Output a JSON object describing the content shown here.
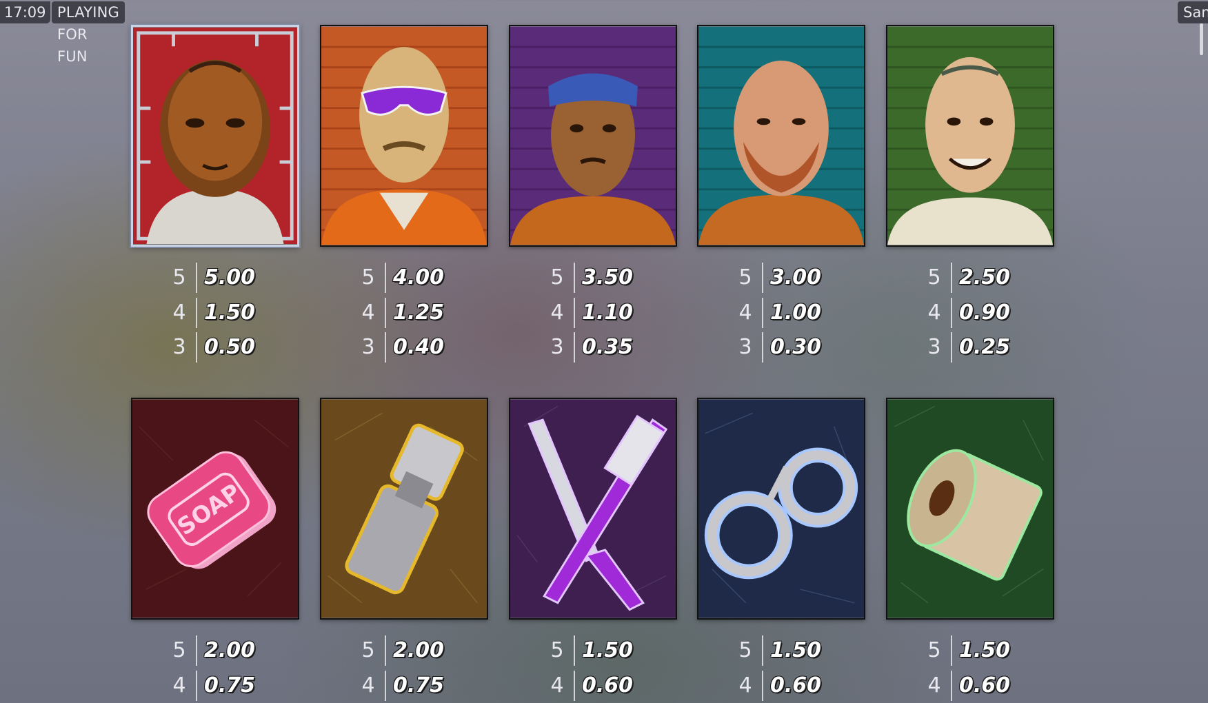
{
  "status_bar": {
    "clock": "17:09",
    "mode": "PLAYING FOR FUN",
    "right_label": "San"
  },
  "paytable": {
    "row1": [
      {
        "name": "red-inmate",
        "icon": "bald-inmate-red-frame-icon",
        "bg": "#b8262a",
        "pays": [
          {
            "count": "5",
            "value": "5.00"
          },
          {
            "count": "4",
            "value": "1.50"
          },
          {
            "count": "3",
            "value": "0.50"
          }
        ]
      },
      {
        "name": "orange-inmate",
        "icon": "inmate-sunglasses-icon",
        "bg": "#c85a26",
        "pays": [
          {
            "count": "5",
            "value": "4.00"
          },
          {
            "count": "4",
            "value": "1.25"
          },
          {
            "count": "3",
            "value": "0.40"
          }
        ]
      },
      {
        "name": "purple-inmate",
        "icon": "inmate-bandana-icon",
        "bg": "#5b2d7a",
        "pays": [
          {
            "count": "5",
            "value": "3.50"
          },
          {
            "count": "4",
            "value": "1.10"
          },
          {
            "count": "3",
            "value": "0.35"
          }
        ]
      },
      {
        "name": "teal-inmate",
        "icon": "bearded-inmate-icon",
        "bg": "#16707a",
        "pays": [
          {
            "count": "5",
            "value": "3.00"
          },
          {
            "count": "4",
            "value": "1.00"
          },
          {
            "count": "3",
            "value": "0.30"
          }
        ]
      },
      {
        "name": "green-inmate",
        "icon": "tattooed-inmate-icon",
        "bg": "#3e6a2c",
        "pays": [
          {
            "count": "5",
            "value": "2.50"
          },
          {
            "count": "4",
            "value": "0.90"
          },
          {
            "count": "3",
            "value": "0.25"
          }
        ]
      }
    ],
    "row2": [
      {
        "name": "soap",
        "icon": "soap-bar-icon",
        "bg": "#4a1418",
        "pays": [
          {
            "count": "5",
            "value": "2.00"
          },
          {
            "count": "4",
            "value": "0.75"
          }
        ]
      },
      {
        "name": "lighter",
        "icon": "lighter-icon",
        "bg": "#6a4a1e",
        "pays": [
          {
            "count": "5",
            "value": "2.00"
          },
          {
            "count": "4",
            "value": "0.75"
          }
        ]
      },
      {
        "name": "shiv-toothbrush",
        "icon": "shiv-toothbrush-icon",
        "bg": "#3e2050",
        "pays": [
          {
            "count": "5",
            "value": "1.50"
          },
          {
            "count": "4",
            "value": "0.60"
          }
        ]
      },
      {
        "name": "handcuffs",
        "icon": "handcuffs-icon",
        "bg": "#1e2a48",
        "pays": [
          {
            "count": "5",
            "value": "1.50"
          },
          {
            "count": "4",
            "value": "0.60"
          }
        ]
      },
      {
        "name": "toilet-paper",
        "icon": "toilet-paper-icon",
        "bg": "#1f4a24",
        "pays": [
          {
            "count": "5",
            "value": "1.50"
          },
          {
            "count": "4",
            "value": "0.60"
          }
        ]
      }
    ],
    "soap_label": "SOAP"
  }
}
